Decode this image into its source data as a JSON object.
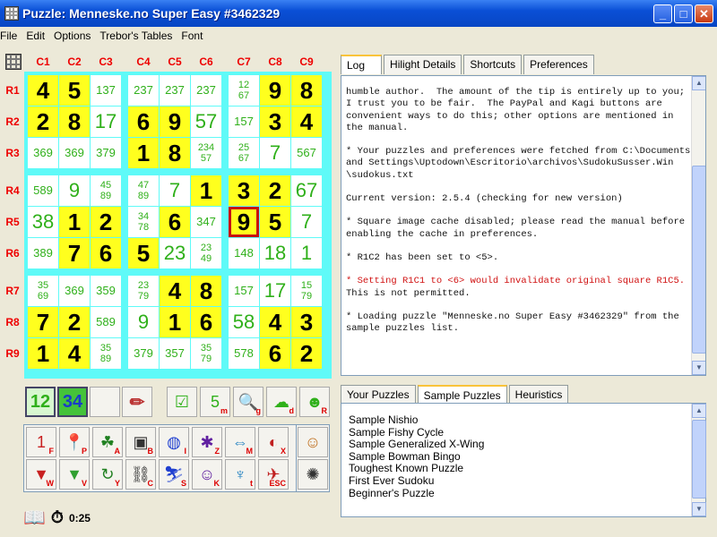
{
  "window": {
    "title": "Puzzle: Menneske.no Super Easy #3462329",
    "controls": [
      "minimize-icon",
      "maximize-icon",
      "close-icon"
    ]
  },
  "menu": [
    "File",
    "Edit",
    "Options",
    "Trebor's Tables",
    "Font"
  ],
  "columns": [
    "C1",
    "C2",
    "C3",
    "C4",
    "C5",
    "C6",
    "C7",
    "C8",
    "C9"
  ],
  "rows": [
    "R1",
    "R2",
    "R3",
    "R4",
    "R5",
    "R6",
    "R7",
    "R8",
    "R9"
  ],
  "board": [
    [
      {
        "t": "g",
        "v": "4"
      },
      {
        "t": "g",
        "v": "5"
      },
      {
        "t": "c",
        "v": "137"
      },
      {
        "t": "c",
        "v": "237"
      },
      {
        "t": "c",
        "v": "237"
      },
      {
        "t": "c",
        "v": "237"
      },
      {
        "t": "c2",
        "v": "12\n67"
      },
      {
        "t": "g",
        "v": "9"
      },
      {
        "t": "g",
        "v": "8"
      }
    ],
    [
      {
        "t": "g",
        "v": "2"
      },
      {
        "t": "g",
        "v": "8"
      },
      {
        "t": "s",
        "v": "17"
      },
      {
        "t": "g",
        "v": "6"
      },
      {
        "t": "g",
        "v": "9"
      },
      {
        "t": "s",
        "v": "57"
      },
      {
        "t": "c",
        "v": "157"
      },
      {
        "t": "g",
        "v": "3"
      },
      {
        "t": "g",
        "v": "4"
      }
    ],
    [
      {
        "t": "c",
        "v": "369"
      },
      {
        "t": "c",
        "v": "369"
      },
      {
        "t": "c",
        "v": "379"
      },
      {
        "t": "g",
        "v": "1"
      },
      {
        "t": "g",
        "v": "8"
      },
      {
        "t": "c2",
        "v": "234\n57"
      },
      {
        "t": "c2",
        "v": "25\n67"
      },
      {
        "t": "s",
        "v": "7"
      },
      {
        "t": "c",
        "v": "567"
      }
    ],
    [
      {
        "t": "c",
        "v": "589"
      },
      {
        "t": "s",
        "v": "9"
      },
      {
        "t": "c2",
        "v": "45\n89"
      },
      {
        "t": "c2",
        "v": "47\n89"
      },
      {
        "t": "s",
        "v": "7"
      },
      {
        "t": "g",
        "v": "1"
      },
      {
        "t": "g",
        "v": "3"
      },
      {
        "t": "g",
        "v": "2"
      },
      {
        "t": "s",
        "v": "67"
      }
    ],
    [
      {
        "t": "s",
        "v": "38"
      },
      {
        "t": "g",
        "v": "1"
      },
      {
        "t": "g",
        "v": "2"
      },
      {
        "t": "c2",
        "v": "34\n78"
      },
      {
        "t": "g",
        "v": "6"
      },
      {
        "t": "c",
        "v": "347"
      },
      {
        "t": "g",
        "v": "9",
        "sel": true
      },
      {
        "t": "g",
        "v": "5"
      },
      {
        "t": "s",
        "v": "7"
      }
    ],
    [
      {
        "t": "c",
        "v": "389"
      },
      {
        "t": "g",
        "v": "7"
      },
      {
        "t": "g",
        "v": "6"
      },
      {
        "t": "g",
        "v": "5"
      },
      {
        "t": "s",
        "v": "23"
      },
      {
        "t": "c2",
        "v": "23\n49"
      },
      {
        "t": "c",
        "v": "148"
      },
      {
        "t": "s",
        "v": "18"
      },
      {
        "t": "s",
        "v": "1"
      }
    ],
    [
      {
        "t": "c2",
        "v": "35\n69"
      },
      {
        "t": "c",
        "v": "369"
      },
      {
        "t": "c",
        "v": "359"
      },
      {
        "t": "c2",
        "v": "23\n79"
      },
      {
        "t": "g",
        "v": "4"
      },
      {
        "t": "g",
        "v": "8"
      },
      {
        "t": "c",
        "v": "157"
      },
      {
        "t": "s",
        "v": "17"
      },
      {
        "t": "c2",
        "v": "15\n79"
      }
    ],
    [
      {
        "t": "g",
        "v": "7"
      },
      {
        "t": "g",
        "v": "2"
      },
      {
        "t": "c",
        "v": "589"
      },
      {
        "t": "s",
        "v": "9"
      },
      {
        "t": "g",
        "v": "1"
      },
      {
        "t": "g",
        "v": "6"
      },
      {
        "t": "s",
        "v": "58"
      },
      {
        "t": "g",
        "v": "4"
      },
      {
        "t": "g",
        "v": "3"
      }
    ],
    [
      {
        "t": "g",
        "v": "1"
      },
      {
        "t": "g",
        "v": "4"
      },
      {
        "t": "c2",
        "v": "35\n89"
      },
      {
        "t": "c",
        "v": "379"
      },
      {
        "t": "c",
        "v": "357"
      },
      {
        "t": "c2",
        "v": "35\n79"
      },
      {
        "t": "c",
        "v": "578"
      },
      {
        "t": "g",
        "v": "6"
      },
      {
        "t": "g",
        "v": "2"
      }
    ]
  ],
  "toolbar1": [
    {
      "name": "candidates-one-button",
      "label": "12"
    },
    {
      "name": "candidates-two-button",
      "label": "34"
    },
    {
      "name": "blank-button",
      "label": ""
    },
    {
      "name": "pencil-button",
      "label": "✏"
    }
  ],
  "toolbar2": [
    {
      "name": "checklist-button",
      "label": "☑",
      "sub": ""
    },
    {
      "name": "five-minute-button",
      "label": "5",
      "sub": "m"
    },
    {
      "name": "magnifier-button",
      "label": "🔍",
      "sub": "g"
    },
    {
      "name": "brain-button",
      "label": "☁",
      "sub": "d"
    },
    {
      "name": "robot-button",
      "label": "☻",
      "sub": "R"
    }
  ],
  "toolbar3": [
    [
      {
        "name": "first-button",
        "label": "1",
        "sub": "F"
      },
      {
        "name": "pin-button",
        "label": "📍",
        "sub": "P"
      },
      {
        "name": "alien-button",
        "label": "☘",
        "sub": "A"
      },
      {
        "name": "robot-b-button",
        "label": "▣",
        "sub": "B"
      },
      {
        "name": "circles-button",
        "label": "◍",
        "sub": "I"
      },
      {
        "name": "bug-button",
        "label": "✱",
        "sub": "Z"
      },
      {
        "name": "arrows-button",
        "label": "⇔",
        "sub": "M"
      },
      {
        "name": "fish-button",
        "label": "◐",
        "sub": "X"
      }
    ],
    [
      {
        "name": "bat-button",
        "label": "▼",
        "sub": "W"
      },
      {
        "name": "bat-v-button",
        "label": "▼",
        "sub": "V"
      },
      {
        "name": "cycle-button",
        "label": "↻",
        "sub": "Y"
      },
      {
        "name": "chain-button",
        "label": "⛓",
        "sub": "C"
      },
      {
        "name": "skier-button",
        "label": "⛷",
        "sub": "S"
      },
      {
        "name": "kids-button",
        "label": "☺",
        "sub": "K"
      },
      {
        "name": "tree-button",
        "label": "♆",
        "sub": "t"
      },
      {
        "name": "escape-button",
        "label": "✈",
        "sub": "ESC"
      }
    ]
  ],
  "sidebar_buttons": [
    {
      "name": "avatar-button",
      "label": "☺"
    },
    {
      "name": "web-button",
      "label": "✺"
    }
  ],
  "log": {
    "tabs": [
      "Log",
      "Hilight Details",
      "Shortcuts",
      "Preferences"
    ],
    "active": "Log",
    "entries": [
      {
        "text": "humble author.  The amount of the tip is entirely up to you; I trust you to be fair.  The PayPal and Kagi buttons are convenient ways to do this; other options are mentioned in the manual.",
        "err": false
      },
      {
        "text": "* Your puzzles and preferences were fetched from C:\\Documents and Settings\\Uptodown\\Escritorio\\archivos\\SudokuSusser.Win \\sudokus.txt",
        "err": false
      },
      {
        "text": "Current version: 2.5.4 (checking for new version)",
        "err": false
      },
      {
        "text": "* Square image cache disabled; please read the manual before enabling the cache in preferences.",
        "err": false
      },
      {
        "text": "* R1C2 has been set to <5>.",
        "err": false
      },
      {
        "text": "* Setting R1C1 to <6> would invalidate original square R1C5.",
        "err": true
      },
      {
        "text": "This is not permitted.",
        "err": false,
        "tight": true
      },
      {
        "text": "* Loading puzzle \"Menneske.no Super Easy #3462329\" from the sample puzzles list.",
        "err": false
      }
    ]
  },
  "puzzles": {
    "tabs": [
      "Your Puzzles",
      "Sample Puzzles",
      "Heuristics"
    ],
    "active": "Sample Puzzles",
    "items": [
      "Sample Nishio",
      "Sample Fishy Cycle",
      "Sample Generalized X-Wing",
      "Sample Bowman Bingo",
      "Toughest Known Puzzle",
      "First Ever Sudoku",
      "Beginner's Puzzle"
    ]
  },
  "timer": {
    "value": "0:25",
    "icons": [
      "book-icon",
      "stopwatch-icon"
    ]
  }
}
